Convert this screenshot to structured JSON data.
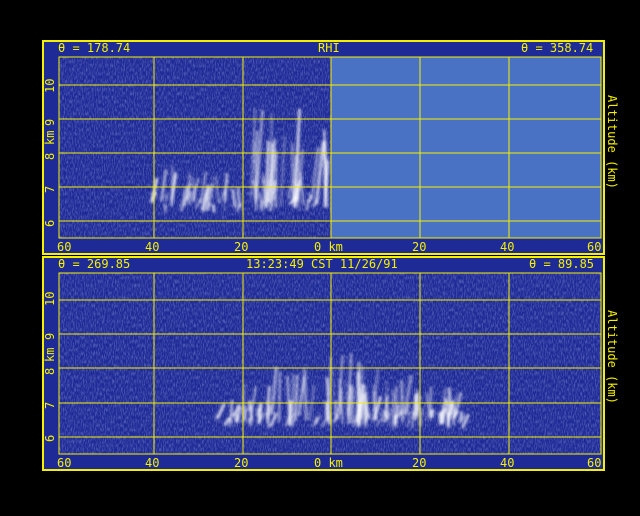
{
  "colors": {
    "background": "#000000",
    "panel_fill": "#1e2a96",
    "empty_fill": "#4a72c4",
    "grid": "#f5f000",
    "echo": "#ffffff"
  },
  "panels": [
    {
      "id": "top",
      "left_angle": "θ = 178.74",
      "center_label": "RHI",
      "right_angle": "θ = 358.74",
      "left_axis_ticks": [
        "10",
        "9",
        "8",
        "7",
        "6"
      ],
      "left_axis_unit": "km",
      "right_axis_label": "Altitude (km)",
      "x_ticks": [
        "60",
        "40",
        "20",
        "0 km",
        "20",
        "40",
        "60"
      ],
      "right_half_no_data": true
    },
    {
      "id": "bottom",
      "left_angle": "θ = 269.85",
      "center_label": "13:23:49 CST 11/26/91",
      "right_angle": "θ = 89.85",
      "left_axis_ticks": [
        "10",
        "9",
        "8",
        "7",
        "6"
      ],
      "left_axis_unit": "km",
      "right_axis_label": "Altitude (km)",
      "x_ticks": [
        "60",
        "40",
        "20",
        "0 km",
        "20",
        "40",
        "60"
      ],
      "right_half_no_data": false
    }
  ]
}
